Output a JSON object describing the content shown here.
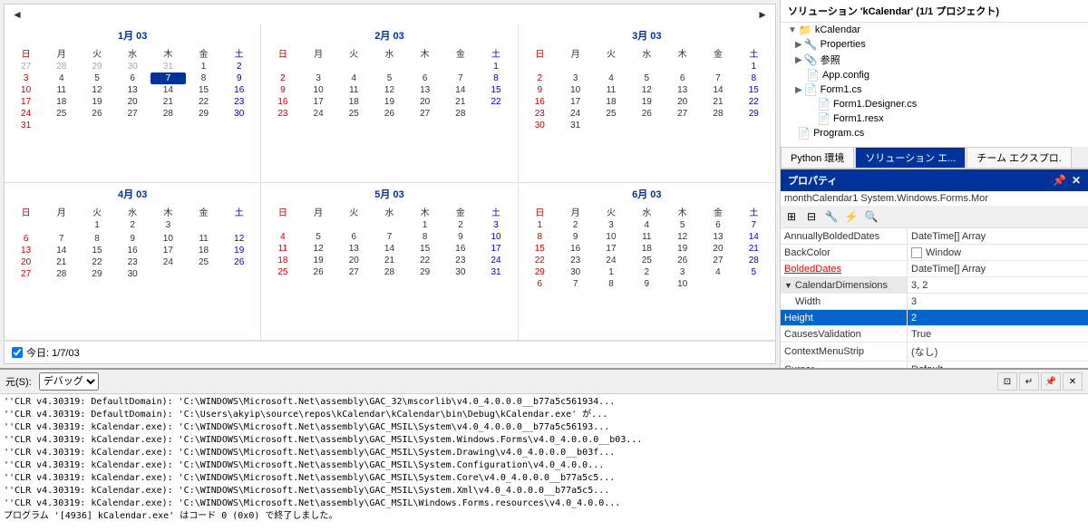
{
  "solution": {
    "title": "ソリューション 'kCalendar' (1/1 プロジェクト)",
    "project": "kCalendar",
    "items": [
      {
        "label": "Properties",
        "icon": "🔧",
        "indent": 16,
        "expandable": true
      },
      {
        "label": "参照",
        "icon": "📎",
        "indent": 16,
        "expandable": true
      },
      {
        "label": "App.config",
        "icon": "📄",
        "indent": 16
      },
      {
        "label": "Form1.cs",
        "icon": "📄",
        "indent": 16,
        "expandable": true
      },
      {
        "label": "Form1.Designer.cs",
        "icon": "📄",
        "indent": 28
      },
      {
        "label": "Form1.resx",
        "icon": "📄",
        "indent": 28
      },
      {
        "label": "Program.cs",
        "icon": "📄",
        "indent": 16,
        "expandable": false
      }
    ]
  },
  "tabs": [
    {
      "label": "Python 環境",
      "active": false
    },
    {
      "label": "ソリューション エ...",
      "active": true
    },
    {
      "label": "チーム エクスプロ.",
      "active": false
    }
  ],
  "properties": {
    "header": "プロパティ",
    "component": "monthCalendar1  System.Windows.Forms.Mor",
    "rows": [
      {
        "name": "AnnuallyBoldedDates",
        "value": "DateTime[] Array",
        "type": "normal"
      },
      {
        "name": "BackColor",
        "value": "Window",
        "swatch": true,
        "type": "normal"
      },
      {
        "name": "BoldedDates",
        "value": "DateTime[] Array",
        "type": "red-underline"
      },
      {
        "name": "CalendarDimensions",
        "value": "3, 2",
        "type": "group-expand",
        "expanded": true
      },
      {
        "name": "Width",
        "value": "3",
        "type": "child"
      },
      {
        "name": "Height",
        "value": "2",
        "type": "selected"
      },
      {
        "name": "CausesValidation",
        "value": "True",
        "type": "normal"
      },
      {
        "name": "ContextMenuStrip",
        "value": "(なし)",
        "type": "normal"
      },
      {
        "name": "Cursor",
        "value": "Default",
        "type": "normal"
      }
    ]
  },
  "output": {
    "label": "元(S):",
    "source": "デバッグ",
    "lines": [
      "'CLR v4.30319: DefaultDomain): 'C:\\WINDOWS\\Microsoft.Net\\assembly\\GAC_32\\mscorlib\\v4.0_4.0.0.0__b77a5c561934...",
      "'CLR v4.30319: DefaultDomain): 'C:\\Users\\akyip\\source\\repos\\kCalendar\\kCalendar\\bin\\Debug\\kCalendar.exe' が...",
      "'CLR v4.30319: kCalendar.exe): 'C:\\WINDOWS\\Microsoft.Net\\assembly\\GAC_MSIL\\System\\v4.0_4.0.0.0__b77a5c56193...",
      "'CLR v4.30319: kCalendar.exe): 'C:\\WINDOWS\\Microsoft.Net\\assembly\\GAC_MSIL\\System.Windows.Forms\\v4.0_4.0.0.0__b03...",
      "'CLR v4.30319: kCalendar.exe): 'C:\\WINDOWS\\Microsoft.Net\\assembly\\GAC_MSIL\\System.Drawing\\v4.0_4.0.0.0__b03f...",
      "'CLR v4.30319: kCalendar.exe): 'C:\\WINDOWS\\Microsoft.Net\\assembly\\GAC_MSIL\\System.Configuration\\v4.0_4.0.0...",
      "'CLR v4.30319: kCalendar.exe): 'C:\\WINDOWS\\Microsoft.Net\\assembly\\GAC_MSIL\\System.Core\\v4.0_4.0.0.0__b77a5c5...",
      "'CLR v4.30319: kCalendar.exe): 'C:\\WINDOWS\\Microsoft.Net\\assembly\\GAC_MSIL\\System.Xml\\v4.0_4.0.0.0__b77a5c5...",
      "'CLR v4.30319: kCalendar.exe): 'C:\\WINDOWS\\Microsoft.Net\\assembly\\GAC_MSIL\\Windows.Forms.resources\\v4.0_4.0.0...",
      "プログラム '[4936] kCalendar.exe' はコード 0 (0x0) で終了しました。"
    ]
  },
  "calendar": {
    "today_label": "今日: 1/7/03",
    "prev_btn": "◄",
    "next_btn": "►",
    "months": [
      {
        "title": "1月 03",
        "days": [
          "日",
          "月",
          "火",
          "水",
          "木",
          "金",
          "土"
        ],
        "weeks": [
          [
            "27",
            "28",
            "29",
            "30",
            "31",
            "1",
            "2"
          ],
          [
            "3",
            "4",
            "5",
            "6",
            "7",
            "8",
            "9"
          ],
          [
            "10",
            "11",
            "12",
            "13",
            "14",
            "15",
            "16"
          ],
          [
            "17",
            "18",
            "19",
            "20",
            "21",
            "22",
            "23"
          ],
          [
            "24",
            "25",
            "26",
            "27",
            "28",
            "29",
            "30"
          ],
          [
            "31",
            "",
            "",
            "",
            "",
            "",
            ""
          ]
        ],
        "otherMonth": [
          [
            0,
            0,
            0,
            0,
            0
          ],
          [],
          [],
          [],
          [],
          [
            0
          ]
        ]
      },
      {
        "title": "2月 03",
        "days": [
          "日",
          "月",
          "火",
          "水",
          "木",
          "金",
          "土"
        ],
        "weeks": [
          [
            "",
            "",
            "",
            "",
            "",
            "",
            "1"
          ],
          [
            "2",
            "3",
            "4",
            "5",
            "6",
            "7",
            "8"
          ],
          [
            "9",
            "10",
            "11",
            "12",
            "13",
            "14",
            "15"
          ],
          [
            "16",
            "17",
            "18",
            "19",
            "20",
            "21",
            "22"
          ],
          [
            "23",
            "24",
            "25",
            "26",
            "27",
            "28",
            ""
          ]
        ]
      },
      {
        "title": "3月 03",
        "days": [
          "日",
          "月",
          "火",
          "水",
          "木",
          "金",
          "土"
        ],
        "weeks": [
          [
            "",
            "",
            "",
            "",
            "",
            "",
            "1"
          ],
          [
            "2",
            "3",
            "4",
            "5",
            "6",
            "7",
            "8"
          ],
          [
            "9",
            "10",
            "11",
            "12",
            "13",
            "14",
            "15"
          ],
          [
            "16",
            "17",
            "18",
            "19",
            "20",
            "21",
            "22"
          ],
          [
            "23",
            "24",
            "25",
            "26",
            "27",
            "28",
            "29"
          ],
          [
            "30",
            "31",
            "",
            "",
            "",
            "",
            ""
          ]
        ]
      },
      {
        "title": "4月 03",
        "days": [
          "日",
          "月",
          "火",
          "水",
          "木",
          "金",
          "土"
        ],
        "weeks": [
          [
            "",
            "",
            "1",
            "2",
            "3",
            "",
            ""
          ],
          [
            "",
            "",
            "",
            "",
            "",
            "",
            ""
          ],
          [
            "6",
            "7",
            "8",
            "9",
            "10",
            "11",
            "12"
          ],
          [
            "13",
            "14",
            "15",
            "16",
            "17",
            "18",
            "19"
          ],
          [
            "20",
            "21",
            "22",
            "23",
            "24",
            "25",
            "26"
          ],
          [
            "27",
            "28",
            "29",
            "30",
            "",
            "",
            ""
          ]
        ]
      },
      {
        "title": "5月 03",
        "days": [
          "日",
          "月",
          "火",
          "水",
          "木",
          "金",
          "土"
        ],
        "weeks": [
          [
            "",
            "",
            "",
            "",
            "1",
            "2",
            "3"
          ],
          [
            "4",
            "5",
            "6",
            "7",
            "8",
            "9",
            "10"
          ],
          [
            "11",
            "12",
            "13",
            "14",
            "15",
            "16",
            "17"
          ],
          [
            "18",
            "19",
            "20",
            "21",
            "22",
            "23",
            "24"
          ],
          [
            "25",
            "26",
            "27",
            "28",
            "29",
            "30",
            "31"
          ]
        ]
      },
      {
        "title": "6月 03",
        "days": [
          "日",
          "月",
          "火",
          "水",
          "木",
          "金",
          "土"
        ],
        "weeks": [
          [
            "1",
            "2",
            "3",
            "4",
            "5",
            "6",
            "7"
          ],
          [
            "8",
            "9",
            "10",
            "11",
            "12",
            "13",
            "14"
          ],
          [
            "15",
            "16",
            "17",
            "18",
            "19",
            "20",
            "21"
          ],
          [
            "22",
            "23",
            "24",
            "25",
            "26",
            "27",
            "28"
          ],
          [
            "29",
            "30",
            "1",
            "2",
            "3",
            "4",
            "5"
          ],
          [
            "6",
            "7",
            "8",
            "9",
            "10",
            "",
            ""
          ]
        ]
      }
    ]
  }
}
